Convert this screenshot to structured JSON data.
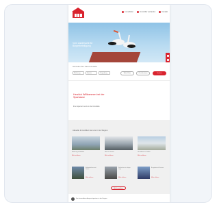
{
  "header": {
    "nav": [
      "Immobilien",
      "Immobilie verkaufen",
      "Kontakt"
    ]
  },
  "hero": {
    "tagline": "Vom Landesamt für Bürgerbeteiligung"
  },
  "search": {
    "title": "Sie finden Ihre Traumimmobilie",
    "fields": [
      "Wohnung",
      "Kaufen",
      "Umgebung"
    ],
    "filter_label": "Mehr Filter",
    "reset_label": "Zurücksetzen",
    "submit_label": "Suchen"
  },
  "welcome": {
    "heading": "Herzlich Willkommen bei der Sparkasse",
    "text": "Ihre Experten rund um die Immobilie"
  },
  "listings": {
    "heading": "Aktuelle Immobilien bei uns in der Region",
    "tiles": [
      {
        "caption": "Wohnung in Mahlow",
        "more": "Mehr erfahren"
      },
      {
        "caption": "Haus in Zossen",
        "more": "Mehr erfahren"
      },
      {
        "caption": "Grundstück in Teltow",
        "more": "Mehr erfahren"
      }
    ],
    "thumbs": [
      {
        "caption": "Einfamilienhaus mit Garten",
        "more": "Mehr erfahren"
      },
      {
        "caption": "Reihenhaus in ruhiger Lage",
        "more": "Mehr erfahren"
      },
      {
        "caption": "Bungalow mit Terrasse",
        "more": "Mehr erfahren"
      }
    ],
    "all_label": "Alle Immobilien"
  },
  "footer": {
    "text": "Ihre Immobilien-Ansprechpartner in der Region"
  },
  "colors": {
    "brand": "#d9232e",
    "sky": "#8fc3e6"
  }
}
